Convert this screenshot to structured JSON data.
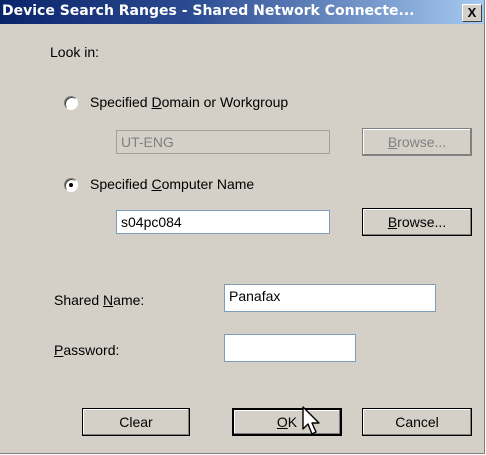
{
  "window": {
    "title": "Device Search Ranges - Shared Network Connecte...",
    "close_symbol": "X"
  },
  "look_in_label": "Look in:",
  "option_domain": {
    "label_pre": "Specified ",
    "label_accel": "D",
    "label_post": "omain or Workgroup",
    "selected": false
  },
  "domain_field": {
    "value": "UT-ENG",
    "enabled": false
  },
  "browse_domain": {
    "label_accel": "B",
    "label_post": "rowse...",
    "enabled": false
  },
  "option_computer": {
    "label_pre": "Specified ",
    "label_accel": "C",
    "label_post": "omputer Name",
    "selected": true
  },
  "computer_field": {
    "value": "s04pc084",
    "enabled": true
  },
  "browse_computer": {
    "label_accel": "B",
    "label_post": "rowse...",
    "enabled": true
  },
  "shared_name": {
    "label_pre": "Shared ",
    "label_accel": "N",
    "label_post": "ame:",
    "value": "Panafax"
  },
  "password": {
    "label_accel": "P",
    "label_post": "assword:",
    "value": ""
  },
  "buttons": {
    "clear": "Clear",
    "ok_accel": "O",
    "ok_post": "K",
    "cancel": "Cancel"
  }
}
